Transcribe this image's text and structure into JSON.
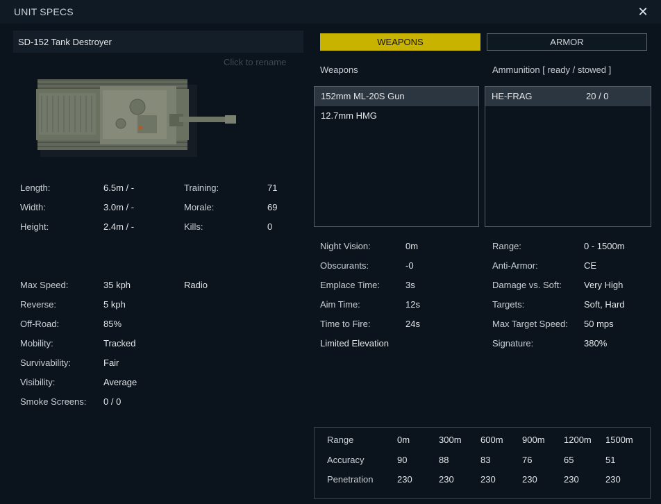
{
  "window": {
    "title": "UNIT SPECS",
    "close_symbol": "✕"
  },
  "unit": {
    "name": "SD-152 Tank Destroyer",
    "rename_hint": "Click to rename"
  },
  "dimensions": [
    {
      "label": "Length:",
      "value": "6.5m / -"
    },
    {
      "label": "Width:",
      "value": "3.0m / -"
    },
    {
      "label": "Height:",
      "value": "2.4m / -"
    }
  ],
  "crew": [
    {
      "label": "Training:",
      "value": "71"
    },
    {
      "label": "Morale:",
      "value": "69"
    },
    {
      "label": "Kills:",
      "value": "0"
    }
  ],
  "mobility": [
    {
      "label": "Max Speed:",
      "value": "35 kph"
    },
    {
      "label": "Reverse:",
      "value": "5 kph"
    },
    {
      "label": "Off-Road:",
      "value": "85%"
    },
    {
      "label": "Mobility:",
      "value": "Tracked"
    },
    {
      "label": "Survivability:",
      "value": "Fair"
    },
    {
      "label": "Visibility:",
      "value": "Average"
    },
    {
      "label": "Smoke Screens:",
      "value": "0 / 0"
    }
  ],
  "equipment": {
    "radio": "Radio"
  },
  "tabs": {
    "weapons": "WEAPONS",
    "armor": "ARMOR"
  },
  "weapons": {
    "header": "Weapons",
    "items": [
      "152mm ML-20S Gun",
      "12.7mm HMG"
    ]
  },
  "ammunition": {
    "header": "Ammunition [ ready / stowed ]",
    "items": [
      {
        "name": "HE-FRAG",
        "count": "20 / 0"
      }
    ]
  },
  "weapon_stats_left": [
    {
      "label": "Night Vision:",
      "value": "0m"
    },
    {
      "label": "Obscurants:",
      "value": "-0"
    },
    {
      "label": "Emplace Time:",
      "value": "3s"
    },
    {
      "label": "Aim Time:",
      "value": "12s"
    },
    {
      "label": "Time to Fire:",
      "value": "24s"
    }
  ],
  "limited_elevation": "Limited Elevation",
  "weapon_stats_right": [
    {
      "label": "Range:",
      "value": "0 - 1500m"
    },
    {
      "label": "Anti-Armor:",
      "value": "CE"
    },
    {
      "label": "Damage vs. Soft:",
      "value": "Very High"
    },
    {
      "label": "Targets:",
      "value": "Soft, Hard"
    },
    {
      "label": "Max Target Speed:",
      "value": "50 mps"
    },
    {
      "label": "Signature:",
      "value": "380%"
    }
  ],
  "range_table": {
    "row_labels": [
      "Range",
      "Accuracy",
      "Penetration"
    ],
    "ranges": [
      "0m",
      "300m",
      "600m",
      "900m",
      "1200m",
      "1500m"
    ],
    "accuracy": [
      "90",
      "88",
      "83",
      "76",
      "65",
      "51"
    ],
    "penetration": [
      "230",
      "230",
      "230",
      "230",
      "230",
      "230"
    ]
  },
  "colors": {
    "background": "#0b141c",
    "accent_tab": "#c8b400",
    "selected_row": "#2c3640",
    "tank_body": "#6e7462"
  },
  "icons": {
    "close": "close-icon",
    "unit_image": "tank-topdown-icon"
  }
}
